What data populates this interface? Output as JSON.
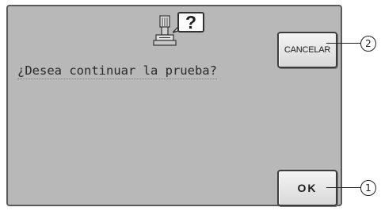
{
  "dialog": {
    "icon": "embroidery-machine-icon",
    "question_mark": "?",
    "message": "¿Desea continuar la prueba?"
  },
  "buttons": {
    "cancel_label": "CANCELAR",
    "ok_label": "OK"
  },
  "callouts": {
    "cancel": "2",
    "ok": "1"
  },
  "colors": {
    "dialog_background": "#b8b8b8",
    "dialog_border": "#5a5a5a",
    "button_face": "#e6e6e6"
  }
}
